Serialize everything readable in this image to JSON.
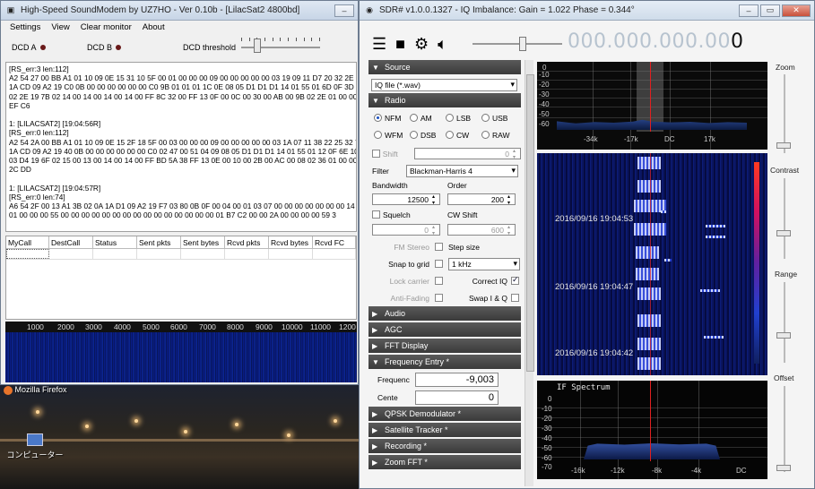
{
  "modem": {
    "title": "High-Speed SoundModem by UZ7HO - Ver 0.10b - [LilacSat2 4800bd]",
    "menu": [
      "Settings",
      "View",
      "Clear monitor",
      "About"
    ],
    "dcd_a": "DCD A",
    "dcd_b": "DCD B",
    "dcd_threshold": "DCD threshold",
    "log": "[RS_err:3 len:112]\nA2 54 27 00 BB A1 01 10 09 0E 15 31 10 5F 00 01 00 00 00 09 00 00 00 00 00 03 19 09 11 D7 20 32 2E 7F\n1A CD 09 A2 19 C0 0B 00 00 00 00 00 00 C0 9B 01 01 01 1C 0E 08 05 D1 D1 D1 14 01 55 01 6D 0F 3D 00\n02 2E 19 7B 02 14 00 14 00 14 00 14 00 FF 8C 32 00 FF 13 0F 00 0C 00 30 00 AB 00 9B 02 2E 01 00 00 00\nEF C6\n\n1: [LILACSAT2] [19:04:56R]\n[RS_err:0 len:112]\nA2 54 2A 00 BB A1 01 10 09 0E 15 2F 18 5F 00 03 00 00 00 09 00 00 00 00 00 03 1A 07 11 38 22 25 32 7F\n1A CD 09 A2 19 40 0B 00 00 00 00 00 00 C0 02 47 00 51 04 09 08 05 D1 D1 D1 14 01 55 01 12 0F 6E 10 70\n03 D4 19 6F 02 15 00 13 00 14 00 14 00 FF BD 5A 38 FF 13 0E 00 10 00 2B 00 AC 00 08 02 36 01 00 00 00\n2C DD\n\n1: [LILACSAT2] [19:04:57R]\n[RS_err:0 len:74]\nA6 54 2F 00 13 A1 3B 02 0A 1A D1 09 A2 19 F7 03 80 0B 0F 00 04 00 01 03 07 00 00 00 00 00 00 00 14 54\n01 00 00 00 55 00 00 00 00 00 00 00 00 00 00 00 00 00 00 00 01 B7 C2 00 00 2A 00 00 00 00 59 3",
    "grid_headers": [
      "MyCall",
      "DestCall",
      "Status",
      "Sent pkts",
      "Sent bytes",
      "Rcvd pkts",
      "Rcvd bytes",
      "Rcvd FC"
    ],
    "scale": [
      "1000",
      "2000",
      "3000",
      "4000",
      "5000",
      "6000",
      "7000",
      "8000",
      "9000",
      "10000",
      "11000",
      "1200"
    ]
  },
  "desktop": {
    "icon_firefox": "Mozilla Firefox",
    "icon_computer": "コンピューター"
  },
  "sdr": {
    "title": "SDR# v1.0.0.1327 - IQ Imbalance: Gain = 1.022 Phase = 0.344°",
    "freq_dim": "000.000.000.00",
    "freq_last": "0",
    "source_label": "Source",
    "source_value": "IQ file (*.wav)",
    "radio_label": "Radio",
    "modes": [
      "NFM",
      "AM",
      "LSB",
      "USB",
      "WFM",
      "DSB",
      "CW",
      "RAW"
    ],
    "shift_label": "Shift",
    "shift_value": "0",
    "filter_label": "Filter",
    "filter_value": "Blackman-Harris 4",
    "bandwidth_label": "Bandwidth",
    "bandwidth_value": "12500",
    "order_label": "Order",
    "order_value": "200",
    "squelch_label": "Squelch",
    "cw_shift_label": "CW Shift",
    "squelch_value": "0",
    "cw_shift_value": "600",
    "fm_stereo": "FM Stereo",
    "step_size": "Step size",
    "snap_label": "Snap to grid",
    "snap_value": "1 kHz",
    "lock_carrier": "Lock carrier",
    "correct_iq": "Correct IQ",
    "anti_fading": "Anti-Fading",
    "swap_iq": "Swap I & Q",
    "sections": [
      "Audio",
      "AGC",
      "FFT Display"
    ],
    "freq_entry": "Frequency Entry *",
    "frequency_label": "Frequenc",
    "frequency_value": "-9,003",
    "center_label": "Cente",
    "center_value": "0",
    "sections2": [
      "QPSK Demodulator *",
      "Satellite Tracker *",
      "Recording *",
      "Zoom FFT *"
    ],
    "top_db": [
      "-10",
      "-20",
      "-30",
      "-40",
      "-50",
      "-60"
    ],
    "top_db_0": "0",
    "top_freq": [
      "-34k",
      "-17k",
      "DC",
      "17k"
    ],
    "timestamps": [
      "2016/09/16 19:04:53",
      "2016/09/16 19:04:47",
      "2016/09/16 19:04:42"
    ],
    "if_title": "IF Spectrum",
    "if_db": [
      "0",
      "-10",
      "-20",
      "-30",
      "-40",
      "-50",
      "-60",
      "-70"
    ],
    "if_freq": [
      "-16k",
      "-12k",
      "-8k",
      "-4k",
      "DC"
    ],
    "rail": [
      "Zoom",
      "Contrast",
      "Range",
      "Offset"
    ]
  }
}
